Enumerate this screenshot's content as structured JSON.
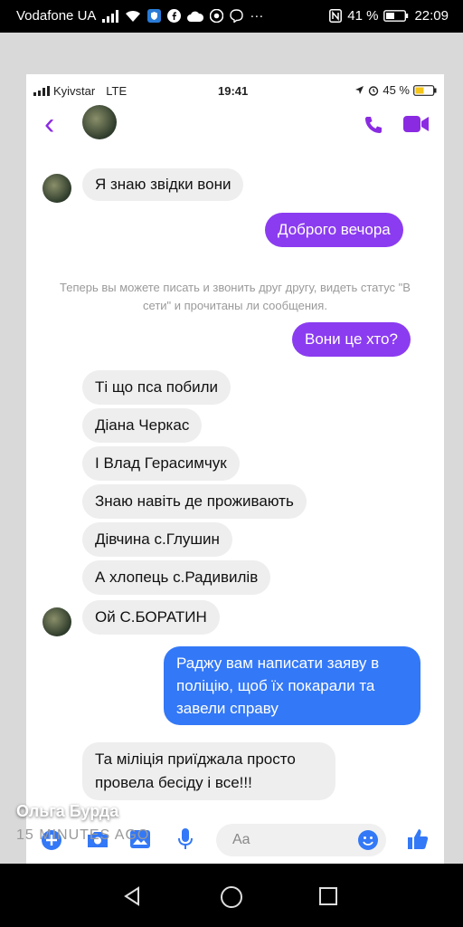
{
  "outer_status": {
    "carrier": "Vodafone UA",
    "battery": "41 %",
    "time": "22:09"
  },
  "inner_status": {
    "carrier": "Kyivstar",
    "network": "LTE",
    "time": "19:41",
    "battery": "45 %"
  },
  "system_notice": "Теперь вы можете писать и звонить друг другу, видеть статус \"В сети\" и прочитаны ли сообщения.",
  "messages": [
    {
      "text": "Я знаю звідки вони"
    },
    {
      "text": "Доброго вечора"
    },
    {
      "text": "Вони це хто?"
    },
    {
      "text": "Ті що пса побили"
    },
    {
      "text": "Діана Черкас"
    },
    {
      "text": "І Влад Герасимчук"
    },
    {
      "text": "Знаю навіть де проживають"
    },
    {
      "text": "Дівчина с.Глушин"
    },
    {
      "text": "А хлопець с.Радивилів"
    },
    {
      "text": "Ой С.БОРАТИН"
    },
    {
      "text": "Раджу вам написати заяву в поліцію, щоб їх покарали та завели справу"
    },
    {
      "text": "Та міліція приїджала просто провела бесіду і все!!!"
    }
  ],
  "composer": {
    "placeholder": "Aa"
  },
  "story_overlay": {
    "author": "Ольга Бурда",
    "posted": "15 MINUTES AGO"
  },
  "colors": {
    "messenger_purple": "#8b3cf0",
    "messenger_blue": "#3378f6",
    "header_accent": "#8a2be2"
  },
  "icons": [
    "signal-icon",
    "wifi-icon",
    "shield-icon",
    "facebook-icon",
    "cloud-icon",
    "chrome-icon",
    "viber-icon",
    "more-icon",
    "nfc-icon",
    "battery-icon",
    "back-icon",
    "phone-icon",
    "video-icon",
    "plus-icon",
    "camera-icon",
    "image-icon",
    "mic-icon",
    "emoji-icon",
    "like-icon",
    "nav-back-icon",
    "nav-home-icon",
    "nav-recents-icon"
  ]
}
